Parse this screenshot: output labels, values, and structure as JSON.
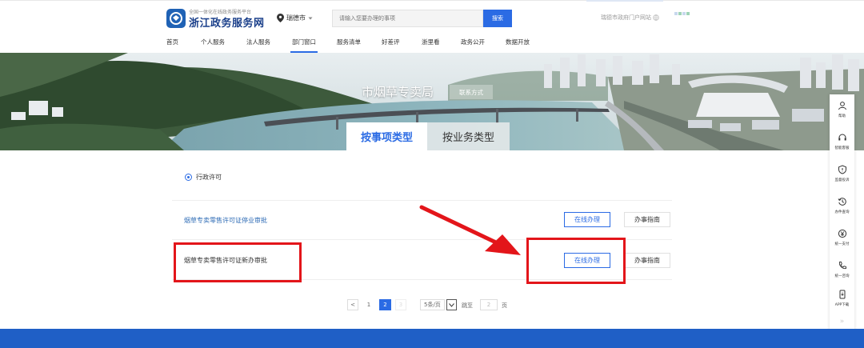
{
  "header": {
    "brand_sub": "全国一体化在线政务服务平台",
    "brand_title": "浙江政务服务网",
    "region": "瑞德市",
    "search_placeholder": "请输入您要办理的事项",
    "search_button": "搜索",
    "portal_text": "瑞德市政府门户网站"
  },
  "nav": {
    "items": [
      "首页",
      "个人服务",
      "法人服务",
      "部门窗口",
      "服务清单",
      "好差评",
      "浙里看",
      "政务公开",
      "数据开放"
    ],
    "active_index": 3
  },
  "banner": {
    "dept_title": "市烟草专卖局",
    "contact_button": "联系方式",
    "tabs": [
      "按事项类型",
      "按业务类型"
    ],
    "active_tab": 0
  },
  "filter": {
    "label": "行政许可"
  },
  "items": [
    {
      "name": "烟草专卖零售许可证停业审批",
      "online": "在线办理",
      "guide": "办事指南"
    },
    {
      "name": "烟草专卖零售许可证新办审批",
      "online": "在线办理",
      "guide": "办事指南"
    }
  ],
  "pagination": {
    "prev": "<",
    "pages": [
      "1",
      "2",
      "3"
    ],
    "current": "2",
    "next": ">",
    "page_size": "5条/页",
    "goto_label": "跳至",
    "goto_value": "2",
    "goto_suffix": "页"
  },
  "sidebar": {
    "items": [
      "帮助",
      "智能客服",
      "监督投诉",
      "办件查询",
      "统一支付",
      "统一咨询",
      "APP下载"
    ]
  },
  "colors": {
    "accent": "#2b6be4",
    "annotation": "#e3151a",
    "footer": "#1f5fc6"
  }
}
